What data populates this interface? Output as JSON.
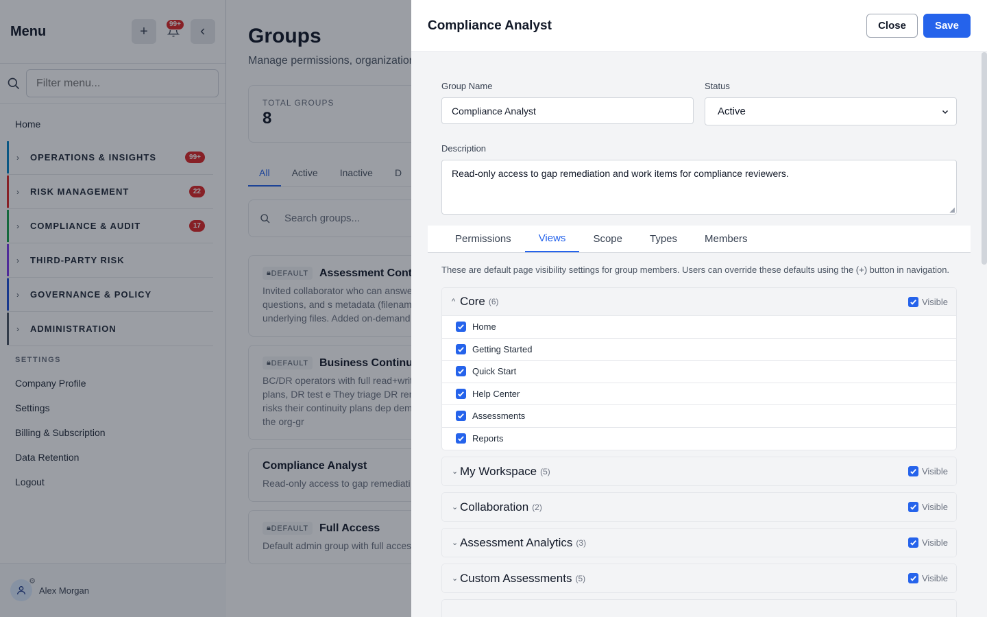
{
  "sidebar": {
    "title": "Menu",
    "notif_badge": "99+",
    "filter_placeholder": "Filter menu...",
    "home_label": "Home",
    "sections": [
      {
        "label": "OPERATIONS & INSIGHTS",
        "badge": "99+",
        "color": "#0284c7"
      },
      {
        "label": "RISK MANAGEMENT",
        "badge": "22",
        "color": "#dc2626"
      },
      {
        "label": "COMPLIANCE & AUDIT",
        "badge": "17",
        "color": "#16a34a"
      },
      {
        "label": "THIRD-PARTY RISK",
        "badge": "",
        "color": "#7c3aed"
      },
      {
        "label": "GOVERNANCE & POLICY",
        "badge": "",
        "color": "#1d4ed8"
      },
      {
        "label": "ADMINISTRATION",
        "badge": "",
        "color": "#4b5563"
      }
    ],
    "settings_heading": "SETTINGS",
    "settings_links": [
      "Company Profile",
      "Settings",
      "Billing & Subscription",
      "Data Retention",
      "Logout"
    ],
    "user_name": "Alex Morgan"
  },
  "main": {
    "title": "Groups",
    "subtitle": "Manage permissions, organization",
    "stat_label": "TOTAL GROUPS",
    "stat_value": "8",
    "tabs": [
      "All",
      "Active",
      "Inactive",
      "D"
    ],
    "search_placeholder": "Search groups...",
    "cards": [
      {
        "badge": "DEFAULT",
        "name": "Assessment Cont",
        "desc": "Invited collaborator who can answe existing artifacts to questions, and s metadata (filename, document type underlying files. Added on-demand allowedGroupIds."
      },
      {
        "badge": "DEFAULT",
        "name": "Business Continu",
        "desc": "BC/DR operators with full read+writ Analyses, recovery plans, DR test e They triage DR remediation from th and risks their continuity plans dep demand by an admin via the org-gr"
      },
      {
        "badge": "",
        "name": "Compliance Analyst",
        "desc": "Read-only access to gap remediati"
      },
      {
        "badge": "DEFAULT",
        "name": "Full Access",
        "desc": "Default admin group with full acces"
      }
    ]
  },
  "drawer": {
    "title": "Compliance Analyst",
    "close_label": "Close",
    "save_label": "Save",
    "group_name_label": "Group Name",
    "group_name_value": "Compliance Analyst",
    "status_label": "Status",
    "status_value": "Active",
    "description_label": "Description",
    "description_value": "Read-only access to gap remediation and work items for compliance reviewers.",
    "tabs": [
      "Permissions",
      "Views",
      "Scope",
      "Types",
      "Members"
    ],
    "active_tab": "Views",
    "views_note": "These are default page visibility settings for group members. Users can override these defaults using the (+) button in navigation.",
    "visible_label": "Visible",
    "groups": [
      {
        "title": "Core",
        "count": "(6)",
        "open": true,
        "items": [
          "Home",
          "Getting Started",
          "Quick Start",
          "Help Center",
          "Assessments",
          "Reports"
        ]
      },
      {
        "title": "My Workspace",
        "count": "(5)",
        "open": false,
        "items": []
      },
      {
        "title": "Collaboration",
        "count": "(2)",
        "open": false,
        "items": []
      },
      {
        "title": "Assessment Analytics",
        "count": "(3)",
        "open": false,
        "items": []
      },
      {
        "title": "Custom Assessments",
        "count": "(5)",
        "open": false,
        "items": []
      }
    ]
  },
  "colors": {
    "accent": "#2563eb",
    "badge_red": "#dc2626"
  }
}
